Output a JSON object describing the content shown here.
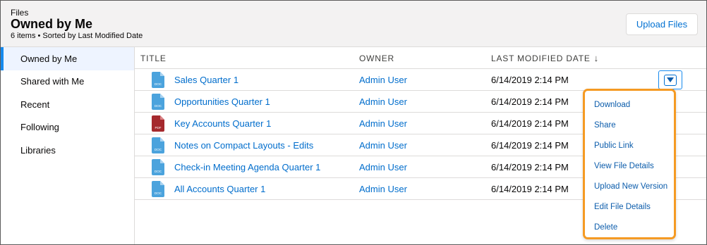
{
  "header": {
    "eyebrow": "Files",
    "title": "Owned by Me",
    "meta": "6 items • Sorted by Last Modified Date",
    "upload_label": "Upload Files"
  },
  "sidebar": {
    "items": [
      {
        "label": "Owned by Me",
        "active": true
      },
      {
        "label": "Shared with Me"
      },
      {
        "label": "Recent"
      },
      {
        "label": "Following"
      },
      {
        "label": "Libraries"
      }
    ]
  },
  "table": {
    "columns": {
      "title": "Title",
      "owner": "Owner",
      "date": "Last Modified Date",
      "sort_indicator": "↓"
    },
    "rows": [
      {
        "name": "Sales Quarter 1",
        "type": "DOC",
        "owner": "Admin User",
        "date": "6/14/2019 2:14 PM"
      },
      {
        "name": "Opportunities Quarter 1",
        "type": "DOC",
        "owner": "Admin User",
        "date": "6/14/2019 2:14 PM"
      },
      {
        "name": "Key Accounts Quarter 1",
        "type": "PDF",
        "owner": "Admin User",
        "date": "6/14/2019 2:14 PM"
      },
      {
        "name": "Notes on Compact Layouts - Edits",
        "type": "DOC",
        "owner": "Admin User",
        "date": "6/14/2019 2:14 PM"
      },
      {
        "name": "Check-in Meeting Agenda Quarter 1",
        "type": "DOC",
        "owner": "Admin User",
        "date": "6/14/2019 2:14 PM"
      },
      {
        "name": "All Accounts Quarter 1",
        "type": "DOC",
        "owner": "Admin User",
        "date": "6/14/2019 2:14 PM"
      }
    ]
  },
  "row_menu": {
    "items": [
      "Download",
      "Share",
      "Public Link",
      "View File Details",
      "Upload New Version",
      "Edit File Details",
      "Delete"
    ]
  },
  "colors": {
    "link": "#006dcc",
    "doc_icon": "#4ba3dd",
    "pdf_icon": "#a5292d",
    "menu_highlight": "#f59a23",
    "active_nav": "#1589ee"
  },
  "icons": {
    "doc": "doc-file-icon",
    "pdf": "pdf-file-icon",
    "menu_toggle": "chevron-down-icon"
  }
}
